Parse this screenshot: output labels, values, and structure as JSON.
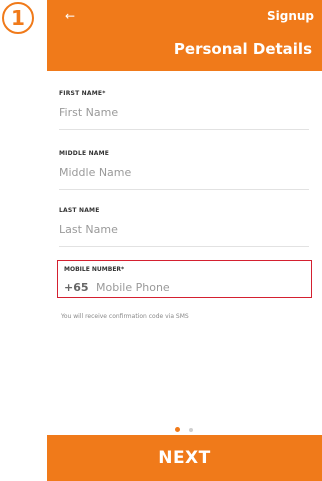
{
  "step": "1",
  "header": {
    "back_icon": "←",
    "signup_label": "Signup",
    "title": "Personal Details"
  },
  "form": {
    "first_name": {
      "label": "FIRST NAME*",
      "placeholder": "First Name"
    },
    "middle_name": {
      "label": "MIDDLE NAME",
      "placeholder": "Middle Name"
    },
    "last_name": {
      "label": "LAST NAME",
      "placeholder": "Last Name"
    },
    "mobile": {
      "label": "MOBILE NUMBER*",
      "country_code": "+65",
      "placeholder": "Mobile Phone"
    },
    "helper_text": "You will receive confirmation code via SMS"
  },
  "pager": {
    "total": 2,
    "active": 1
  },
  "footer": {
    "next_label": "NEXT"
  },
  "colors": {
    "accent": "#f07a1a",
    "highlight": "#d42030"
  }
}
